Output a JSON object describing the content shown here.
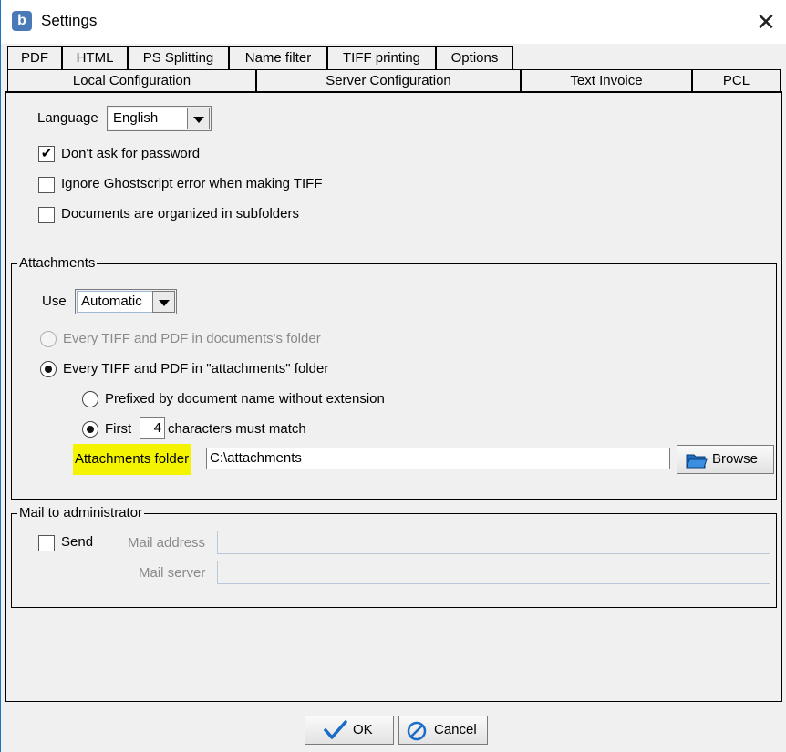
{
  "window": {
    "title": "Settings",
    "app_icon": "b",
    "close_glyph": "✕"
  },
  "tabs_row1": [
    "PDF",
    "HTML",
    "PS Splitting",
    "Name filter",
    "TIFF printing",
    "Options"
  ],
  "tabs_row2": [
    "Local Configuration",
    "Server Configuration",
    "Text Invoice",
    "PCL"
  ],
  "general": {
    "language_label": "Language",
    "language_value": "English",
    "dont_ask_password": {
      "label": "Don't ask for password",
      "checked": true,
      "mark": "✔"
    },
    "ignore_ghostscript": {
      "label": "Ignore Ghostscript error when making TIFF",
      "checked": false
    },
    "organized_subfolders": {
      "label": "Documents are organized in subfolders",
      "checked": false
    }
  },
  "attachments": {
    "legend": "Attachments",
    "use_label": "Use",
    "use_value": "Automatic",
    "opt_documents_folder": "Every TIFF and PDF in documents's folder",
    "opt_attachments_folder": "Every TIFF and PDF in \"attachments\" folder",
    "opt_prefixed": "Prefixed by document name without extension",
    "opt_first": "First",
    "first_count": "4",
    "opt_chars_match": "characters must match",
    "folder_label": "Attachments folder",
    "folder_value": "C:\\attachments",
    "browse_label": "Browse",
    "highlight_color": "#f4f400"
  },
  "mail": {
    "legend": "Mail to administrator",
    "send_label": "Send",
    "address_label": "Mail address",
    "server_label": "Mail server"
  },
  "footer": {
    "ok_label": "OK",
    "cancel_label": "Cancel"
  }
}
